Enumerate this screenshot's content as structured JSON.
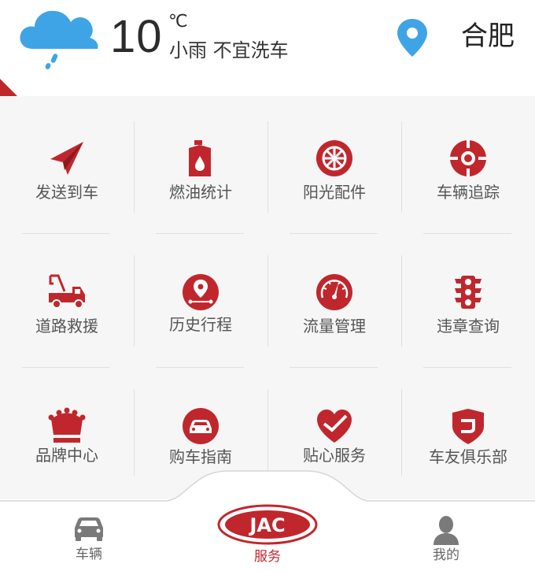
{
  "weather": {
    "icon": "rain-cloud-icon",
    "temperature": "10",
    "unit": "℃",
    "condition": "小雨 不宜洗车"
  },
  "location": {
    "icon": "location-pin-icon",
    "city": "合肥"
  },
  "services": [
    {
      "label": "发送到车",
      "icon": "paper-plane-icon"
    },
    {
      "label": "燃油统计",
      "icon": "fuel-can-icon"
    },
    {
      "label": "阳光配件",
      "icon": "wheel-icon"
    },
    {
      "label": "车辆追踪",
      "icon": "target-icon"
    },
    {
      "label": "道路救援",
      "icon": "tow-truck-icon"
    },
    {
      "label": "历史行程",
      "icon": "route-pin-icon"
    },
    {
      "label": "流量管理",
      "icon": "gauge-icon"
    },
    {
      "label": "违章查询",
      "icon": "traffic-light-icon"
    },
    {
      "label": "品牌中心",
      "icon": "crown-icon"
    },
    {
      "label": "购车指南",
      "icon": "car-circle-icon"
    },
    {
      "label": "贴心服务",
      "icon": "heart-icon"
    },
    {
      "label": "车友俱乐部",
      "icon": "club-shield-icon"
    }
  ],
  "bottom_nav": [
    {
      "label": "车辆",
      "icon": "car-icon",
      "active": false
    },
    {
      "label": "服务",
      "icon": "jac-logo",
      "active": true,
      "logo_text": "JAC"
    },
    {
      "label": "我的",
      "icon": "user-icon",
      "active": false
    }
  ],
  "colors": {
    "accent": "#c0272d",
    "weather_blue": "#3fa4e6",
    "inactive_gray": "#777777"
  }
}
